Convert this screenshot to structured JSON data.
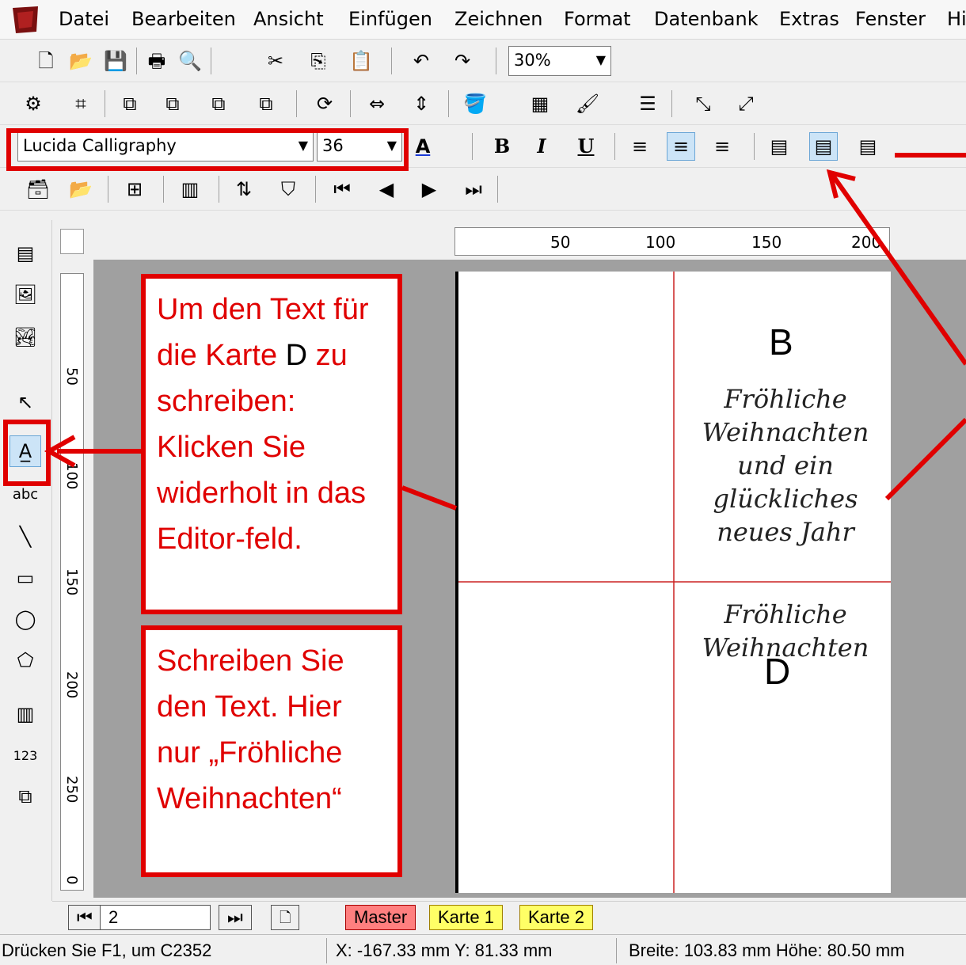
{
  "menu": [
    "Datei",
    "Bearbeiten",
    "Ansicht",
    "Einfügen",
    "Zeichnen",
    "Format",
    "Datenbank",
    "Extras",
    "Fenster",
    "Hi"
  ],
  "toolbar": {
    "zoom": "30%"
  },
  "format_bar": {
    "font": "Lucida Calligraphy",
    "size": "36",
    "bold": "B",
    "italic": "I",
    "underline": "U",
    "font_color": "A"
  },
  "ruler": {
    "h_ticks": [
      "50",
      "100",
      "150",
      "200"
    ],
    "v_ticks": [
      "50",
      "100",
      "150",
      "200",
      "250",
      "0"
    ]
  },
  "cards": {
    "b_letter": "B",
    "b_text": "Fröhliche Weihnachten und ein glückliches neues Jahr",
    "d_letter": "D",
    "d_text": "Fröhliche Weihnachten"
  },
  "callouts": {
    "first_red": "Um den Text für die Karte",
    "first_black": "D",
    "first_rest": "zu schreiben: Klicken Sie widerholt in das Editor-feld.",
    "second": "Schreiben Sie den Text. Hier nur „Fröhliche Weihnachten“"
  },
  "tabs": {
    "page": "2",
    "master": "Master",
    "karte1": "Karte 1",
    "karte2": "Karte 2"
  },
  "status": {
    "help": "Drücken Sie F1, um  C2352",
    "coords": "X: -167.33 mm  Y: 81.33 mm",
    "size": "Breite: 103.83 mm  Höhe: 80.50 mm"
  },
  "colors": {
    "accent": "#e00000",
    "tab_master": "#ff7f7f",
    "tab_karte": "#ffff66"
  }
}
